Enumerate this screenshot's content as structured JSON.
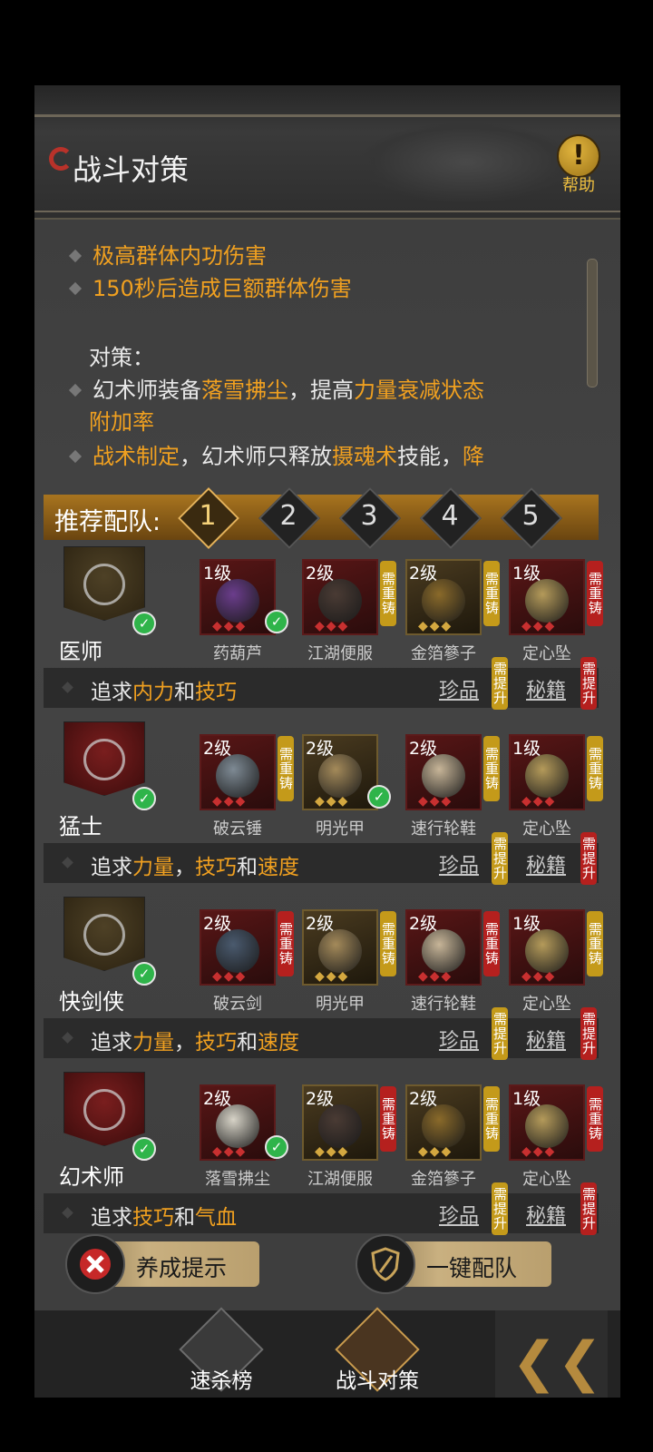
{
  "header": {
    "title": "战斗对策",
    "help_label": "帮助",
    "help_glyph": "!"
  },
  "description": {
    "lines": [
      {
        "bullet": true,
        "parts": [
          {
            "t": "极高群体内功伤害",
            "c": "o"
          }
        ]
      },
      {
        "bullet": true,
        "parts": [
          {
            "t": "150秒后造成巨额群体伤害",
            "c": "o"
          }
        ]
      },
      {
        "bullet": false,
        "parts": [
          {
            "t": "对策：",
            "c": "w"
          }
        ]
      },
      {
        "bullet": true,
        "parts": [
          {
            "t": "幻术师装备",
            "c": "w"
          },
          {
            "t": "落雪拂尘",
            "c": "o"
          },
          {
            "t": "，提高",
            "c": "w"
          },
          {
            "t": "力量衰减状态",
            "c": "o"
          }
        ]
      },
      {
        "bullet": false,
        "parts": [
          {
            "t": "附加率",
            "c": "o"
          }
        ]
      },
      {
        "bullet": true,
        "parts": [
          {
            "t": "战术制定",
            "c": "o"
          },
          {
            "t": "，幻术师只释放",
            "c": "w"
          },
          {
            "t": "摄魂术",
            "c": "o"
          },
          {
            "t": "技能，",
            "c": "w"
          },
          {
            "t": "降",
            "c": "o"
          }
        ]
      }
    ]
  },
  "recommend": {
    "label": "推荐配队:",
    "tabs": [
      "1",
      "2",
      "3",
      "4",
      "5"
    ],
    "selected": 0
  },
  "roster": [
    {
      "name": "医师",
      "crest": "gold",
      "checked": true,
      "items": [
        {
          "level": "1级",
          "name": "药葫芦",
          "frame": "red",
          "checked": true,
          "tag": null,
          "art": "#6b3d8c"
        },
        {
          "level": "2级",
          "name": "江湖便服",
          "frame": "red",
          "checked": false,
          "tag": {
            "text": "需重铸",
            "color": "y"
          },
          "art": "#4a3b34"
        },
        {
          "level": "2级",
          "name": "金箔篸子",
          "frame": "gold",
          "checked": false,
          "tag": {
            "text": "需重铸",
            "color": "y"
          },
          "art": "#8a6a2a"
        },
        {
          "level": "1级",
          "name": "定心坠",
          "frame": "red",
          "checked": false,
          "tag": {
            "text": "需重铸",
            "color": "r"
          },
          "art": "#b49a5a"
        }
      ],
      "pursuit": [
        {
          "t": "追求",
          "c": "w"
        },
        {
          "t": "内力",
          "c": "o"
        },
        {
          "t": "和",
          "c": "w"
        },
        {
          "t": "技巧",
          "c": "o"
        }
      ],
      "treasure": {
        "label": "珍品",
        "tag": "需提升",
        "color": "y"
      },
      "manual": {
        "label": "秘籍",
        "tag": "需提升",
        "color": "r"
      }
    },
    {
      "name": "猛士",
      "crest": "red",
      "checked": true,
      "items": [
        {
          "level": "2级",
          "name": "破云锤",
          "frame": "red",
          "checked": false,
          "tag": {
            "text": "需重铸",
            "color": "y"
          },
          "art": "#7e8a94"
        },
        {
          "level": "2级",
          "name": "明光甲",
          "frame": "gold",
          "checked": true,
          "tag": null,
          "art": "#a48a5a"
        },
        {
          "level": "2级",
          "name": "速行轮鞋",
          "frame": "red",
          "checked": false,
          "tag": {
            "text": "需重铸",
            "color": "y"
          },
          "art": "#c7b598"
        },
        {
          "level": "1级",
          "name": "定心坠",
          "frame": "red",
          "checked": false,
          "tag": {
            "text": "需重铸",
            "color": "y"
          },
          "art": "#b49a5a"
        }
      ],
      "pursuit": [
        {
          "t": "追求",
          "c": "w"
        },
        {
          "t": "力量",
          "c": "o"
        },
        {
          "t": "，",
          "c": "w"
        },
        {
          "t": "技巧",
          "c": "o"
        },
        {
          "t": "和",
          "c": "w"
        },
        {
          "t": "速度",
          "c": "o"
        }
      ],
      "treasure": {
        "label": "珍品",
        "tag": "需提升",
        "color": "y"
      },
      "manual": {
        "label": "秘籍",
        "tag": "需提升",
        "color": "r"
      }
    },
    {
      "name": "快剑侠",
      "crest": "gold",
      "checked": true,
      "items": [
        {
          "level": "2级",
          "name": "破云剑",
          "frame": "red",
          "checked": false,
          "tag": {
            "text": "需重铸",
            "color": "r"
          },
          "art": "#4a5a6e"
        },
        {
          "level": "2级",
          "name": "明光甲",
          "frame": "gold",
          "checked": false,
          "tag": {
            "text": "需重铸",
            "color": "y"
          },
          "art": "#a48a5a"
        },
        {
          "level": "2级",
          "name": "速行轮鞋",
          "frame": "red",
          "checked": false,
          "tag": {
            "text": "需重铸",
            "color": "r"
          },
          "art": "#c7b598"
        },
        {
          "level": "1级",
          "name": "定心坠",
          "frame": "red",
          "checked": false,
          "tag": {
            "text": "需重铸",
            "color": "y"
          },
          "art": "#b49a5a"
        }
      ],
      "pursuit": [
        {
          "t": "追求",
          "c": "w"
        },
        {
          "t": "力量",
          "c": "o"
        },
        {
          "t": "，",
          "c": "w"
        },
        {
          "t": "技巧",
          "c": "o"
        },
        {
          "t": "和",
          "c": "w"
        },
        {
          "t": "速度",
          "c": "o"
        }
      ],
      "treasure": {
        "label": "珍品",
        "tag": "需提升",
        "color": "y"
      },
      "manual": {
        "label": "秘籍",
        "tag": "需提升",
        "color": "r"
      }
    },
    {
      "name": "幻术师",
      "crest": "red",
      "checked": true,
      "items": [
        {
          "level": "2级",
          "name": "落雪拂尘",
          "frame": "red",
          "checked": true,
          "tag": null,
          "art": "#d7d3c7"
        },
        {
          "level": "2级",
          "name": "江湖便服",
          "frame": "gold",
          "checked": false,
          "tag": {
            "text": "需重铸",
            "color": "r"
          },
          "art": "#4a3b34"
        },
        {
          "level": "2级",
          "name": "金箔篸子",
          "frame": "gold",
          "checked": false,
          "tag": {
            "text": "需重铸",
            "color": "y"
          },
          "art": "#8a6a2a"
        },
        {
          "level": "1级",
          "name": "定心坠",
          "frame": "red",
          "checked": false,
          "tag": {
            "text": "需重铸",
            "color": "r"
          },
          "art": "#b49a5a"
        }
      ],
      "pursuit": [
        {
          "t": "追求",
          "c": "w"
        },
        {
          "t": "技巧",
          "c": "o"
        },
        {
          "t": "和",
          "c": "w"
        },
        {
          "t": "气血",
          "c": "o"
        }
      ],
      "treasure": {
        "label": "珍品",
        "tag": "需提升",
        "color": "y"
      },
      "manual": {
        "label": "秘籍",
        "tag": "需提升",
        "color": "r"
      }
    }
  ],
  "buttons": {
    "tips": "养成提示",
    "auto_team": "一键配队"
  },
  "footer": {
    "tab1": "速杀榜",
    "tab2": "战斗对策"
  },
  "colors": {
    "accent": "#f0a020",
    "tag_yellow": "#c49a1a",
    "tag_red": "#b5201e"
  }
}
